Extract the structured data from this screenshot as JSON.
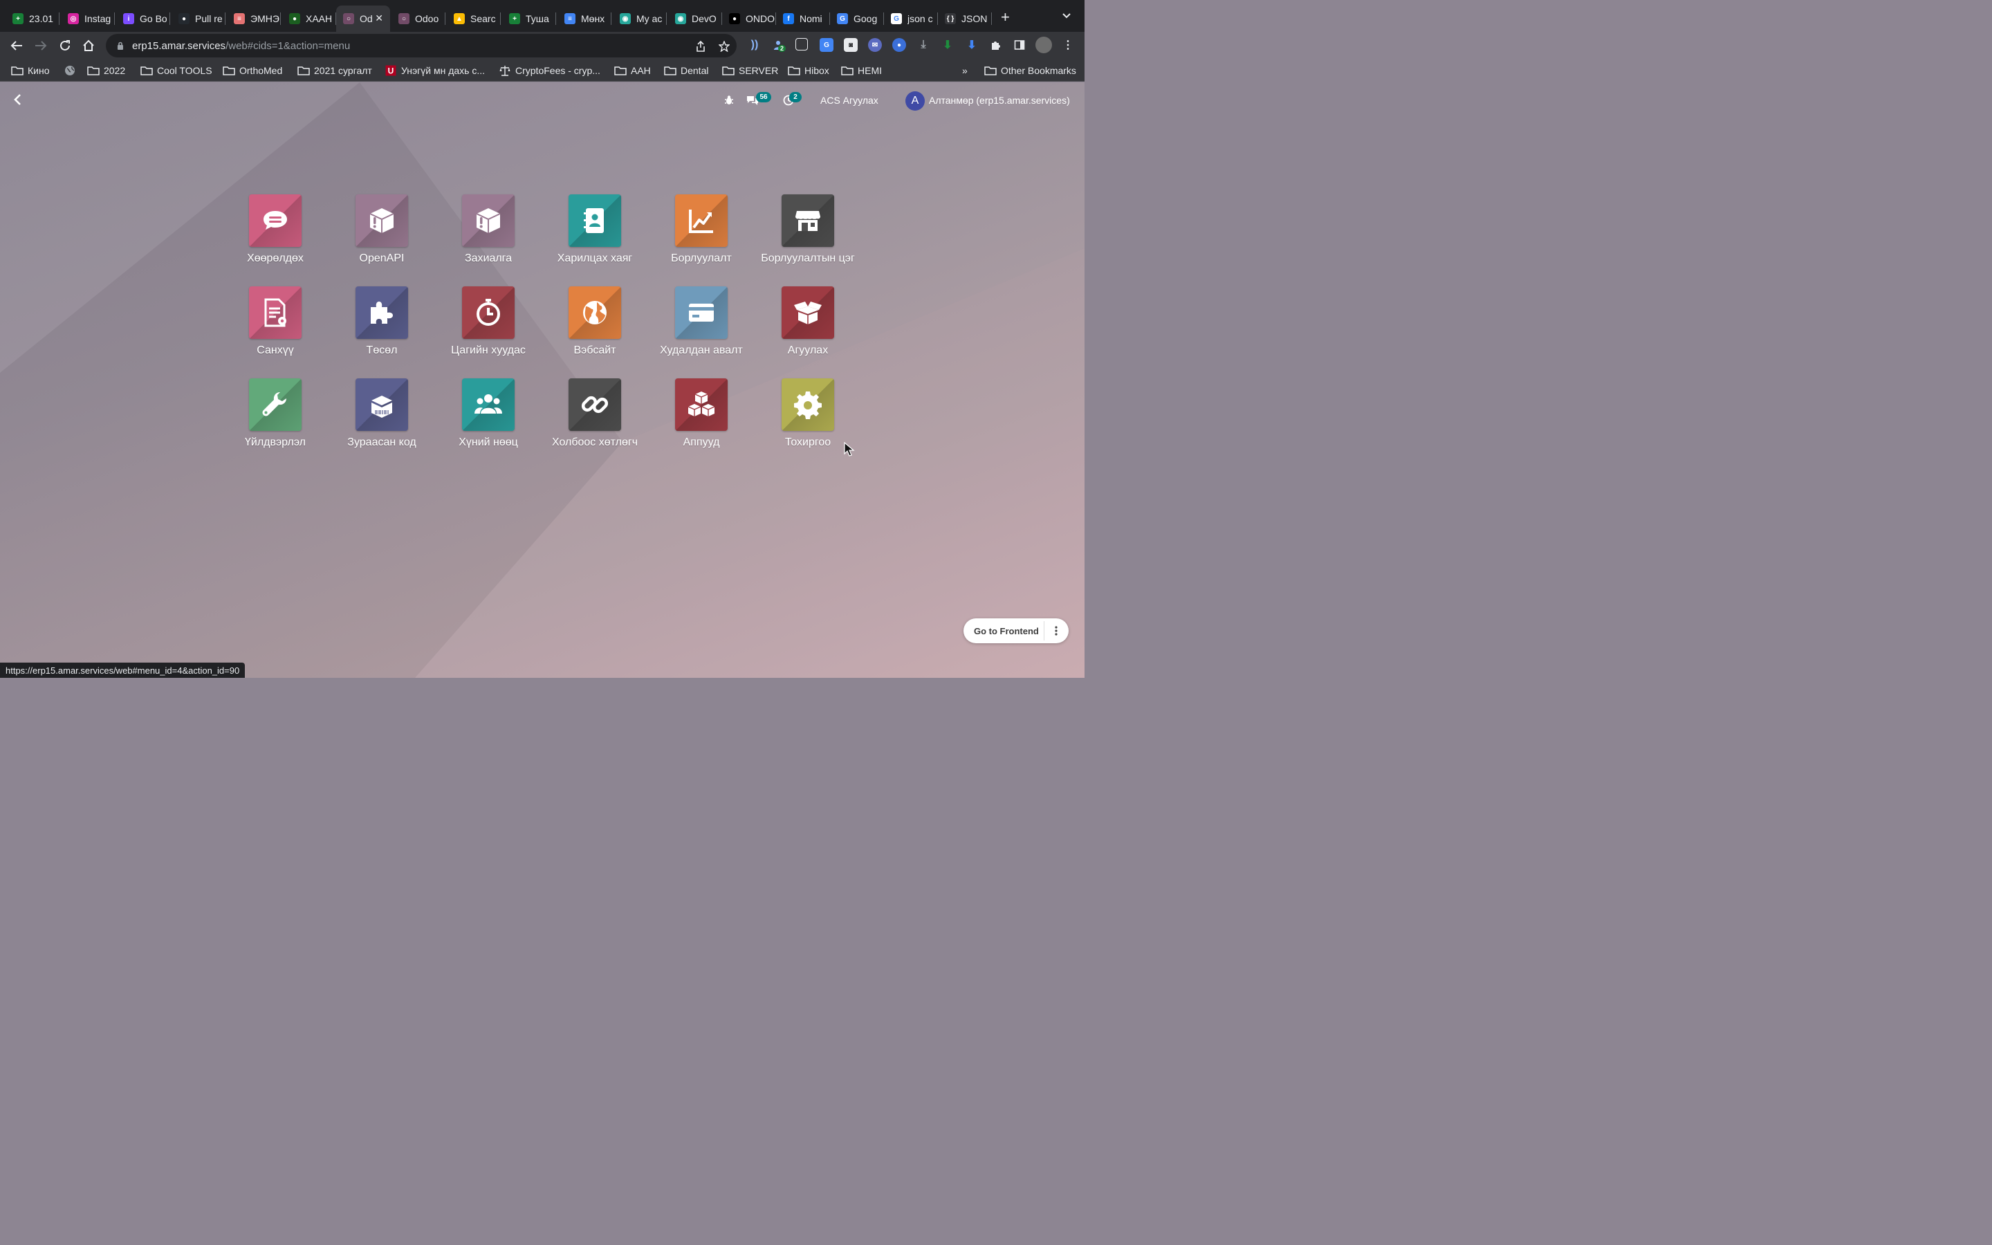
{
  "browser": {
    "tabs": [
      {
        "title": "23.01",
        "fav_color": "#188038",
        "fav_glyph": "+",
        "active": false
      },
      {
        "title": "Instag",
        "fav_color": "#d6249f",
        "fav_glyph": "◎",
        "active": false
      },
      {
        "title": "Go Bo",
        "fav_color": "#7c4dff",
        "fav_glyph": "i",
        "active": false
      },
      {
        "title": "Pull re",
        "fav_color": "#24292f",
        "fav_glyph": "●",
        "active": false
      },
      {
        "title": "ЭМНЭ",
        "fav_color": "#e57373",
        "fav_glyph": "≡",
        "active": false
      },
      {
        "title": "ХААН",
        "fav_color": "#1b5e20",
        "fav_glyph": "●",
        "active": false
      },
      {
        "title": "Od",
        "fav_color": "#714b67",
        "fav_glyph": "○",
        "active": true
      },
      {
        "title": "Odoo",
        "fav_color": "#714b67",
        "fav_glyph": "○",
        "active": false
      },
      {
        "title": "Searc",
        "fav_color": "#fbbc04",
        "fav_glyph": "▲",
        "active": false
      },
      {
        "title": "Туша",
        "fav_color": "#188038",
        "fav_glyph": "+",
        "active": false
      },
      {
        "title": "Мөнх",
        "fav_color": "#4285f4",
        "fav_glyph": "≡",
        "active": false
      },
      {
        "title": "My ac",
        "fav_color": "#26a69a",
        "fav_glyph": "◉",
        "active": false
      },
      {
        "title": "DevO",
        "fav_color": "#26a69a",
        "fav_glyph": "◉",
        "active": false
      },
      {
        "title": "ONDO",
        "fav_color": "#000000",
        "fav_glyph": "●",
        "active": false
      },
      {
        "title": "Nomi",
        "fav_color": "#1877f2",
        "fav_glyph": "f",
        "active": false
      },
      {
        "title": "Goog",
        "fav_color": "#4285f4",
        "fav_glyph": "G",
        "active": false
      },
      {
        "title": "json c",
        "fav_color": "#ffffff",
        "fav_glyph": "G",
        "active": false
      },
      {
        "title": "JSON",
        "fav_color": "#35363a",
        "fav_glyph": "{ }",
        "active": false
      }
    ],
    "url_host": "erp15.amar.services",
    "url_path": "/web#cids=1&action=menu",
    "extension_badge": "2",
    "bookmarks": [
      {
        "label": "Кино",
        "icon": "folder-icon"
      },
      {
        "label": "",
        "icon": "globe-icon"
      },
      {
        "label": "2022",
        "icon": "folder-icon"
      },
      {
        "label": "Cool TOOLS",
        "icon": "folder-icon"
      },
      {
        "label": "OrthoMed",
        "icon": "folder-icon"
      },
      {
        "label": "2021 сургалт",
        "icon": "folder-icon"
      },
      {
        "label": "Унэгүй мн дахь с...",
        "icon": "u-icon"
      },
      {
        "label": "CryptoFees - cryp...",
        "icon": "scale-icon"
      },
      {
        "label": "AAH",
        "icon": "folder-icon"
      },
      {
        "label": "Dental",
        "icon": "folder-icon"
      },
      {
        "label": "SERVER",
        "icon": "folder-icon"
      },
      {
        "label": "Hibox",
        "icon": "folder-icon"
      },
      {
        "label": "HEMI",
        "icon": "folder-icon"
      }
    ],
    "bookmarks_overflow": "»",
    "other_bookmarks": "Other Bookmarks",
    "status_url": "https://erp15.amar.services/web#menu_id=4&action_id=90"
  },
  "odoo": {
    "messages_count": "56",
    "activities_count": "2",
    "company": "ACS Агуулах",
    "avatar_letter": "A",
    "user_name": "Алтанмөр (erp15.amar.services)",
    "apps": [
      {
        "label": "Хөөрөлдөх",
        "icon": "chat-icon",
        "color": "#cf5f81"
      },
      {
        "label": "OpenAPI",
        "icon": "box-alert-icon",
        "color": "#9a7a92"
      },
      {
        "label": "Захиалга",
        "icon": "box-alert-icon",
        "color": "#9a7a92"
      },
      {
        "label": "Харилцах хаяг",
        "icon": "contacts-icon",
        "color": "#2a9d9b"
      },
      {
        "label": "Борлуулалт",
        "icon": "sales-chart-icon",
        "color": "#e28140"
      },
      {
        "label": "Борлуулалтын цэг",
        "icon": "shop-icon",
        "color": "#4f4f4f"
      },
      {
        "label": "Санхүү",
        "icon": "invoice-icon",
        "color": "#cf5f81"
      },
      {
        "label": "Төсөл",
        "icon": "puzzle-icon",
        "color": "#5b5f8f"
      },
      {
        "label": "Цагийн хуудас",
        "icon": "stopwatch-icon",
        "color": "#a2434b"
      },
      {
        "label": "Вэбсайт",
        "icon": "globe-icon",
        "color": "#e28140"
      },
      {
        "label": "Худалдан авалт",
        "icon": "credit-card-icon",
        "color": "#6f9bbb"
      },
      {
        "label": "Агуулах",
        "icon": "open-box-icon",
        "color": "#9e3b43"
      },
      {
        "label": "Үйлдвэрлэл",
        "icon": "wrench-icon",
        "color": "#62a97a"
      },
      {
        "label": "Зураасан код",
        "icon": "barcode-box-icon",
        "color": "#5b5f8f"
      },
      {
        "label": "Хүний нөөц",
        "icon": "people-icon",
        "color": "#2a9d9b"
      },
      {
        "label": "Холбоос хөтлөгч",
        "icon": "link-icon",
        "color": "#4f4f4f"
      },
      {
        "label": "Аппууд",
        "icon": "cubes-icon",
        "color": "#9e3b43"
      },
      {
        "label": "Тохиргоо",
        "icon": "gear-icon",
        "color": "#b3b052"
      }
    ],
    "go_frontend": "Go to Frontend"
  }
}
